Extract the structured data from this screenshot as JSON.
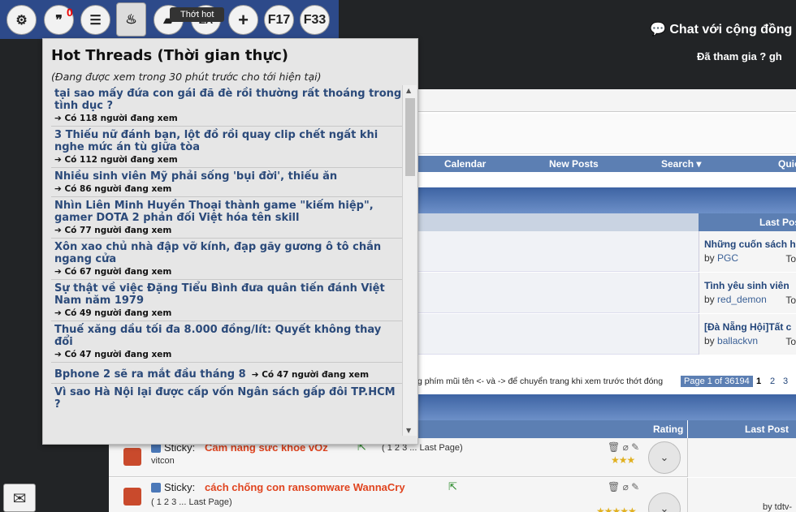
{
  "toolbar": {
    "buttons": [
      {
        "name": "settings-button",
        "icon": "gear-icon",
        "glyph": "⚙"
      },
      {
        "name": "quotes-button",
        "icon": "quote-icon",
        "glyph": "❞"
      },
      {
        "name": "list-button",
        "icon": "list-icon",
        "glyph": "☰"
      },
      {
        "name": "hot-button",
        "icon": "flame-icon",
        "glyph": "🔥"
      },
      {
        "name": "bookmark-button",
        "icon": "bookmark-icon",
        "glyph": "▰"
      },
      {
        "name": "zoom-button",
        "icon": "text-size-icon",
        "glyph": "ZA"
      },
      {
        "name": "add-button",
        "icon": "plus-icon",
        "glyph": "+"
      },
      {
        "name": "f17-button",
        "label": "F17"
      },
      {
        "name": "f33-button",
        "label": "F33"
      }
    ],
    "quote_badge": "0",
    "tooltip": "Thớt hot",
    "accent": "#2d4a8a"
  },
  "header": {
    "chat_link": "Chat với cộng đồng",
    "chat_icon": "chat-icon",
    "join_text": "Đã tham gia ? gh"
  },
  "navbar": {
    "items": [
      "Calendar",
      "New Posts",
      "Search ▾",
      "Quic"
    ]
  },
  "forum_rows": {
    "last_post_header": "Last Pos",
    "rows": [
      {
        "title": "Những cuốn sách h",
        "by_label": "by",
        "user": "PGC",
        "to": "To"
      },
      {
        "title": "Tình yêu sinh viên",
        "by_label": "by",
        "user": "red_demon",
        "to": "To"
      },
      {
        "title": "[Đà Nẵng Hội]Tất c",
        "by_label": "by",
        "user": "ballackvn",
        "to": "To"
      }
    ]
  },
  "pager": {
    "hint": "g phím mũi tên <- và -> để chuyển trang khi xem trước thớt đóng",
    "page_info": "Page 1 of 36194",
    "pages": [
      "1",
      "2",
      "3"
    ]
  },
  "threads": {
    "rating_header": "Rating",
    "last_post_header": "Last Post",
    "items": [
      {
        "sticky": "Sticky:",
        "title": "Cẩm nang sức khoẻ vOz",
        "pages": "( 1 2 3 ... Last Page)",
        "author": "vitcon",
        "stars": "★★★"
      },
      {
        "sticky": "Sticky:",
        "title": "cách chống con ransomware WannaCry",
        "pages": "( 1 2 3 ... Last Page)",
        "author": "",
        "stars": "★★★★★",
        "lp_user": "by tdtv-"
      }
    ]
  },
  "hot_threads": {
    "title": "Hot Threads (Thời gian thực)",
    "subtitle": "(Đang được xem trong 30 phút trước cho tới hiện tại)",
    "items": [
      {
        "title": "tại sao mấy đứa con gái đã đè rồi thường rất thoáng trong tình dục ?",
        "viewers": "Có 118 người đang xem"
      },
      {
        "title": "3 Thiếu nữ đánh bạn, lột đồ rồi quay clip chết ngất khi nghe mức án tù giữa tòa",
        "viewers": "Có 112 người đang xem"
      },
      {
        "title": "Nhiều sinh viên Mỹ phải sống 'bụi đời', thiếu ăn",
        "viewers": "Có 86 người đang xem"
      },
      {
        "title": "Nhìn Liên Minh Huyền Thoại thành game \"kiếm hiệp\", gamer DOTA 2 phản đối Việt hóa tên skill",
        "viewers": "Có 77 người đang xem"
      },
      {
        "title": "Xôn xao chủ nhà đập vỡ kính, đạp gãy gương ô tô chắn ngang cửa",
        "viewers": "Có 67 người đang xem"
      },
      {
        "title": "Sự thật về việc Đặng Tiểu Bình đưa quân tiến đánh Việt Nam năm 1979",
        "viewers": "Có 49 người đang xem"
      },
      {
        "title": "Thuế xăng dầu tối đa 8.000 đồng/lít: Quyết không thay đổi",
        "viewers": "Có 47 người đang xem"
      },
      {
        "title": "Bphone 2 sẽ ra mắt đầu tháng 8",
        "viewers": "Có 47 người đang xem",
        "inline": true
      },
      {
        "title": "Vì sao Hà Nội lại được cấp vốn Ngân sách gấp đôi TP.HCM ?",
        "viewers": ""
      }
    ]
  },
  "sidebar": {
    "mail_icon": "mail-icon"
  }
}
